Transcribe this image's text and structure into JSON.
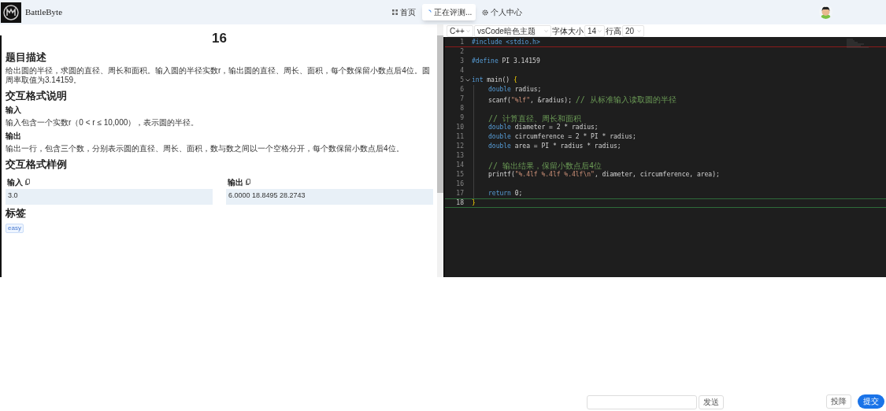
{
  "header": {
    "brand": "BattleByte",
    "nav": [
      {
        "label": "首页",
        "kind": "link"
      },
      {
        "label": "正在评测...",
        "kind": "status"
      },
      {
        "label": "个人中心",
        "kind": "link"
      }
    ]
  },
  "problem": {
    "title": "16",
    "sections": [
      {
        "kind": "h2",
        "text": "题目描述"
      },
      {
        "kind": "p",
        "text": "给出圆的半径，求圆的直径、周长和面积。输入圆的半径实数r，输出圆的直径、周长、面积，每个数保留小数点后4位。圆周率取值为3.14159。"
      },
      {
        "kind": "h2",
        "text": "交互格式说明"
      },
      {
        "kind": "h3",
        "text": "输入"
      },
      {
        "kind": "p",
        "text": "输入包含一个实数r（0 < r ≤ 10,000），表示圆的半径。"
      },
      {
        "kind": "h3",
        "text": "输出"
      },
      {
        "kind": "p",
        "text": "输出一行，包含三个数，分别表示圆的直径、周长、面积，数与数之间以一个空格分开，每个数保留小数点后4位。"
      },
      {
        "kind": "h2",
        "text": "交互格式样例"
      }
    ],
    "samples": [
      {
        "label": "输入",
        "value": "3.0"
      },
      {
        "label": "输出",
        "value": "6.0000 18.8495 28.2743"
      }
    ],
    "tags_title": "标签",
    "tags": [
      "easy"
    ]
  },
  "editor": {
    "toolbar": [
      {
        "kind": "select",
        "value": "C++"
      },
      {
        "kind": "select",
        "value": "vsCode暗色主题"
      },
      {
        "kind": "label",
        "value": "字体大小"
      },
      {
        "kind": "select",
        "value": "14"
      },
      {
        "kind": "label",
        "value": "行高"
      },
      {
        "kind": "select",
        "value": "20"
      }
    ],
    "lines": [
      {
        "number": "1",
        "current": false,
        "fold": false,
        "indented": false,
        "segments": [
          {
            "kind": "macro",
            "text": "#include <stdio.h>"
          }
        ]
      },
      {
        "number": "2",
        "current": false,
        "fold": false,
        "indented": false
      },
      {
        "number": "3",
        "current": false,
        "fold": false,
        "indented": false,
        "segments": [
          {
            "kind": "macro",
            "text": "#define"
          },
          {
            "kind": "plain",
            "text": " PI 3.14159"
          }
        ]
      },
      {
        "number": "4",
        "current": false,
        "fold": false,
        "indented": false
      },
      {
        "number": "5",
        "current": false,
        "fold": true,
        "indented": false,
        "segments": [
          {
            "kind": "keyword",
            "text": "int"
          },
          {
            "kind": "plain",
            "text": " main() "
          },
          {
            "kind": "brace",
            "text": "{"
          }
        ]
      },
      {
        "number": "6",
        "current": false,
        "fold": false,
        "indented": true,
        "segments": [
          {
            "kind": "keyword",
            "text": "double"
          },
          {
            "kind": "plain",
            "text": " radius;"
          }
        ]
      },
      {
        "number": "7",
        "current": false,
        "fold": false,
        "indented": true,
        "segments": [
          {
            "kind": "plain",
            "text": "scanf("
          },
          {
            "kind": "string",
            "text": "\"%lf\""
          },
          {
            "kind": "plain",
            "text": ", &radius); "
          },
          {
            "kind": "comment",
            "text": "// 从标准输入读取圆的半径"
          }
        ]
      },
      {
        "number": "8",
        "current": false,
        "fold": false,
        "indented": true
      },
      {
        "number": "9",
        "current": false,
        "fold": false,
        "indented": true,
        "segments": [
          {
            "kind": "comment",
            "text": "// 计算直径、周长和面积"
          }
        ]
      },
      {
        "number": "10",
        "current": false,
        "fold": false,
        "indented": true,
        "segments": [
          {
            "kind": "keyword",
            "text": "double"
          },
          {
            "kind": "plain",
            "text": " diameter = 2 * radius;"
          }
        ]
      },
      {
        "number": "11",
        "current": false,
        "fold": false,
        "indented": true,
        "segments": [
          {
            "kind": "keyword",
            "text": "double"
          },
          {
            "kind": "plain",
            "text": " circumference = 2 * PI * radius;"
          }
        ]
      },
      {
        "number": "12",
        "current": false,
        "fold": false,
        "indented": true,
        "segments": [
          {
            "kind": "keyword",
            "text": "double"
          },
          {
            "kind": "plain",
            "text": " area = PI * radius * radius;"
          }
        ]
      },
      {
        "number": "13",
        "current": false,
        "fold": false,
        "indented": true
      },
      {
        "number": "14",
        "current": false,
        "fold": false,
        "indented": true,
        "segments": [
          {
            "kind": "comment",
            "text": "// 输出结果，保留小数点后4位"
          }
        ]
      },
      {
        "number": "15",
        "current": false,
        "fold": false,
        "indented": true,
        "segments": [
          {
            "kind": "plain",
            "text": "printf("
          },
          {
            "kind": "string",
            "text": "\"%.4lf %.4lf %.4lf\\n\""
          },
          {
            "kind": "plain",
            "text": ", diameter, circumference, area);"
          }
        ]
      },
      {
        "number": "16",
        "current": false,
        "fold": false,
        "indented": true
      },
      {
        "number": "17",
        "current": false,
        "fold": false,
        "indented": true,
        "segments": [
          {
            "kind": "keyword",
            "text": "return"
          },
          {
            "kind": "plain",
            "text": " 0;"
          }
        ]
      },
      {
        "number": "18",
        "current": true,
        "fold": false,
        "indented": false,
        "segments": [
          {
            "kind": "brace",
            "text": "}"
          }
        ]
      }
    ]
  },
  "footer": {
    "send": "发送",
    "surrender": "投降",
    "submit": "提交"
  }
}
